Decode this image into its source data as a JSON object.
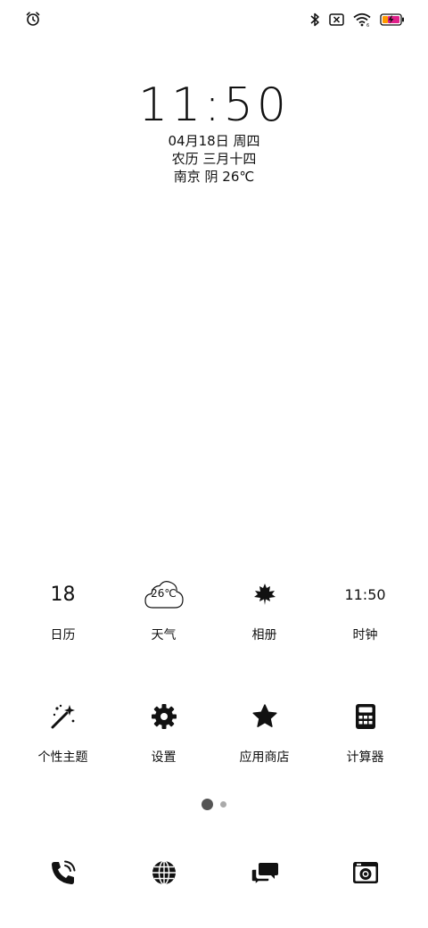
{
  "status_bar": {
    "left_icons": [
      "alarm-icon"
    ],
    "right_icons": [
      "bluetooth-icon",
      "sim-off-icon",
      "wifi-icon",
      "battery-charging-icon"
    ]
  },
  "clock_widget": {
    "time": "11:50",
    "date": "04月18日 周四",
    "lunar": "农历 三月十四",
    "weather": "南京 阴 26℃"
  },
  "apps": {
    "row1": [
      {
        "label": "日历",
        "icon": "calendar-icon",
        "icon_text": "18"
      },
      {
        "label": "天气",
        "icon": "weather-cloud-icon",
        "icon_text": "26℃"
      },
      {
        "label": "相册",
        "icon": "maple-leaf-icon"
      },
      {
        "label": "时钟",
        "icon": "clock-icon",
        "icon_text": "11:50"
      }
    ],
    "row2": [
      {
        "label": "个性主题",
        "icon": "magic-wand-icon"
      },
      {
        "label": "设置",
        "icon": "gear-icon"
      },
      {
        "label": "应用商店",
        "icon": "star-icon"
      },
      {
        "label": "计算器",
        "icon": "calculator-icon"
      }
    ]
  },
  "page_indicator": {
    "pages": 2,
    "current": 1
  },
  "dock": [
    {
      "icon": "phone-icon"
    },
    {
      "icon": "globe-icon"
    },
    {
      "icon": "messages-icon"
    },
    {
      "icon": "camera-icon"
    }
  ]
}
